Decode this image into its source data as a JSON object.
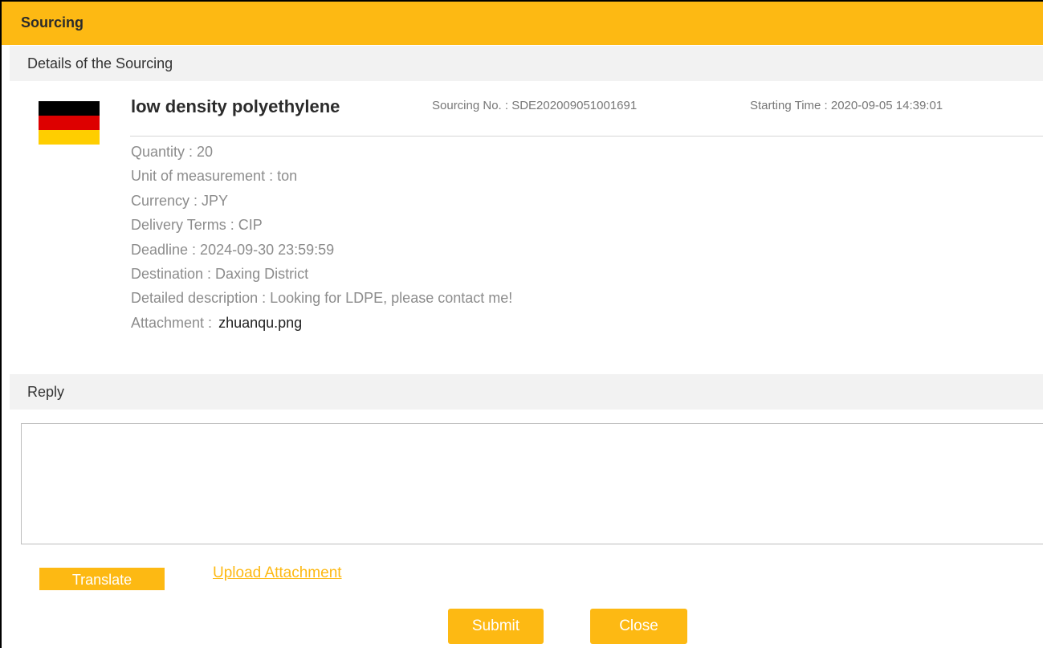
{
  "window": {
    "title": "Sourcing"
  },
  "details_section": {
    "label": "Details of the Sourcing"
  },
  "product": {
    "flag_colors": [
      "#000000",
      "#dd0000",
      "#ffce00"
    ],
    "name": "low density polyethylene",
    "sourcing_no": "Sourcing No. : SDE202009051001691",
    "starting_time": "Starting Time : 2020-09-05 14:39:01"
  },
  "fields": {
    "quantity": "Quantity : 20",
    "unit": "Unit of measurement : ton",
    "currency": "Currency : JPY",
    "delivery_terms": "Delivery Terms : CIP",
    "deadline": "Deadline : 2024-09-30 23:59:59",
    "destination": "Destination : Daxing District",
    "description": "Detailed description : Looking for LDPE, please contact me!",
    "attachment_label": "Attachment :",
    "attachment_file": "zhuanqu.png"
  },
  "reply_section": {
    "label": "Reply",
    "value": "",
    "placeholder": ""
  },
  "actions": {
    "translate": "Translate",
    "upload": "Upload Attachment",
    "submit": "Submit",
    "close": "Close"
  },
  "colors": {
    "accent": "#fdb913",
    "section_bg": "#f2f2f2"
  }
}
